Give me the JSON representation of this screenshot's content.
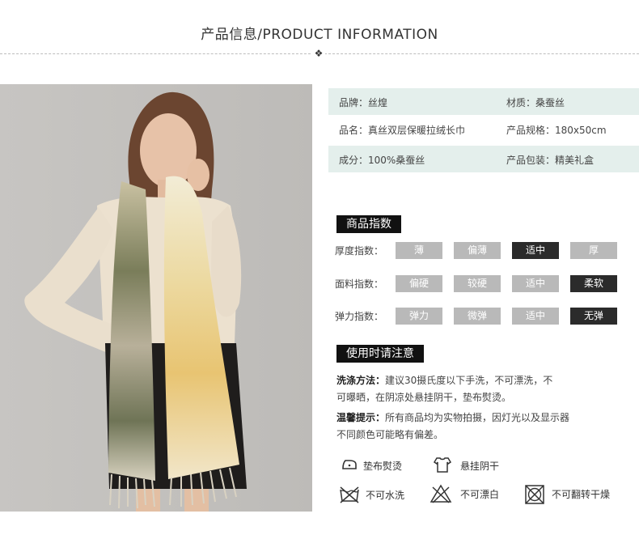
{
  "header": {
    "title": "产品信息/PRODUCT INFORMATION",
    "divider_mark": "❖"
  },
  "info": [
    {
      "left": "品牌：丝煌",
      "right": "材质：桑蚕丝",
      "shaded": true
    },
    {
      "left": "品名：真丝双层保暖拉绒长巾",
      "right": "产品规格：180x50cm",
      "shaded": false
    },
    {
      "left": "成分：100%桑蚕丝",
      "right": "产品包装：精美礼盒",
      "shaded": true
    }
  ],
  "index_section": {
    "title": "商品指数",
    "rows": [
      {
        "label": "厚度指数：",
        "options": [
          "薄",
          "偏薄",
          "适中",
          "厚"
        ],
        "selected": 2
      },
      {
        "label": "面料指数：",
        "options": [
          "偏硬",
          "较硬",
          "适中",
          "柔软"
        ],
        "selected": 3
      },
      {
        "label": "弹力指数：",
        "options": [
          "弹力",
          "微弹",
          "适中",
          "无弹"
        ],
        "selected": 3
      }
    ]
  },
  "care_section": {
    "title": "使用时请注意",
    "wash_title": "洗涤方法：",
    "wash_line1": "建议30摄氏度以下手洗，不可漂洗，不",
    "wash_line2": "可曝晒，在阴凉处悬挂阴干，垫布熨烫。",
    "tip_title": "温馨提示：",
    "tip_line1": "所有商品均为实物拍摄，因灯光以及显示器",
    "tip_line2": "不同颜色可能略有偏差。",
    "symbols": [
      {
        "icon": "iron-icon",
        "label": "垫布熨烫"
      },
      {
        "icon": "hang-dry-icon",
        "label": "悬挂阴干"
      },
      {
        "icon": "no-machine-wash-icon",
        "label": "不可水洗"
      },
      {
        "icon": "no-bleach-icon",
        "label": "不可漂白"
      },
      {
        "icon": "no-tumble-dry-icon",
        "label": "不可翻转干燥"
      }
    ]
  }
}
